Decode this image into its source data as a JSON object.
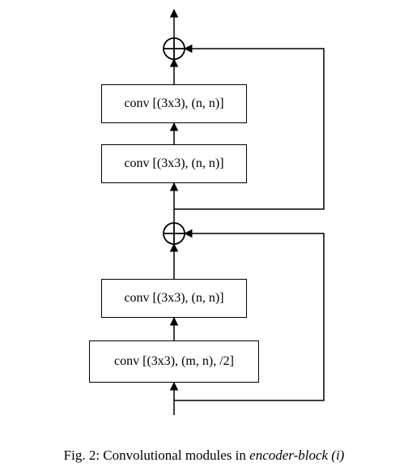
{
  "blocks": {
    "b1": "conv [(3x3), (m, n), /2]",
    "b2": "conv [(3x3), (n, n)]",
    "b3": "conv [(3x3), (n, n)]",
    "b4": "conv [(3x3), (n, n)]"
  },
  "caption": {
    "label": "Fig. 2:",
    "text": " Convolutional modules in ",
    "emph": "encoder-block (i)"
  },
  "chart_data": {
    "type": "diagram",
    "title": "Convolutional modules in encoder-block (i)",
    "nodes": [
      {
        "id": "input",
        "kind": "input"
      },
      {
        "id": "conv1",
        "kind": "conv",
        "kernel": "3x3",
        "channels_in": "m",
        "channels_out": "n",
        "stride": 2
      },
      {
        "id": "conv2",
        "kind": "conv",
        "kernel": "3x3",
        "channels_in": "n",
        "channels_out": "n"
      },
      {
        "id": "add1",
        "kind": "add"
      },
      {
        "id": "conv3",
        "kind": "conv",
        "kernel": "3x3",
        "channels_in": "n",
        "channels_out": "n"
      },
      {
        "id": "conv4",
        "kind": "conv",
        "kernel": "3x3",
        "channels_in": "n",
        "channels_out": "n"
      },
      {
        "id": "add2",
        "kind": "add"
      },
      {
        "id": "output",
        "kind": "output"
      }
    ],
    "edges": [
      {
        "from": "input",
        "to": "conv1"
      },
      {
        "from": "conv1",
        "to": "conv2"
      },
      {
        "from": "conv2",
        "to": "add1"
      },
      {
        "from": "input",
        "to": "add1",
        "skip": true
      },
      {
        "from": "add1",
        "to": "conv3"
      },
      {
        "from": "conv3",
        "to": "conv4"
      },
      {
        "from": "conv4",
        "to": "add2"
      },
      {
        "from": "add1",
        "to": "add2",
        "skip": true
      },
      {
        "from": "add2",
        "to": "output"
      }
    ]
  }
}
